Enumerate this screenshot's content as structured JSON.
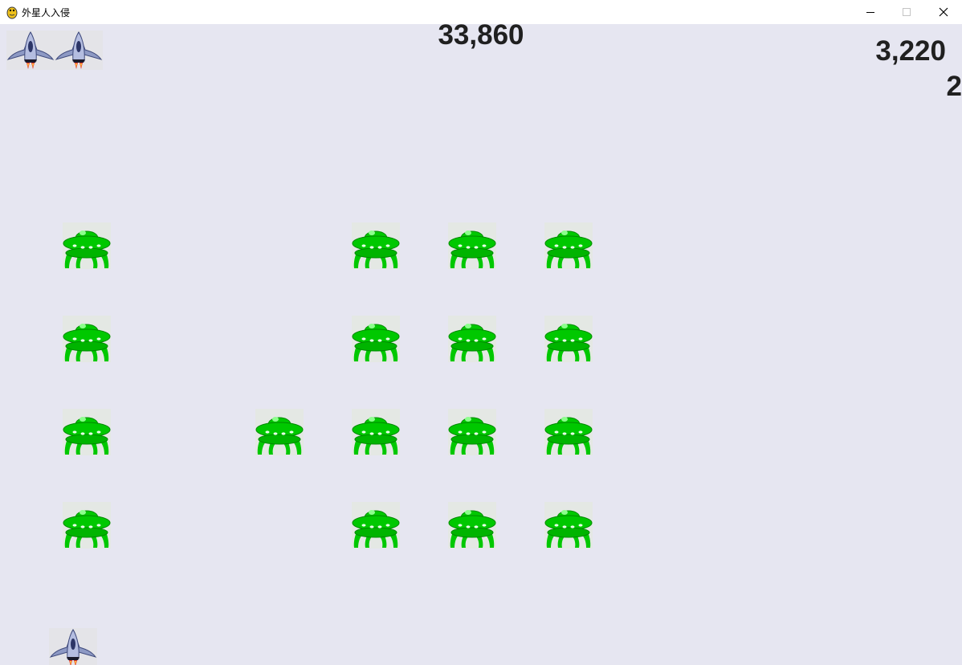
{
  "window": {
    "title": "外星人入侵",
    "icon": "pygame-snake-icon"
  },
  "controls": {
    "minimize": "minimize-icon",
    "maximize": "maximize-icon",
    "close": "close-icon"
  },
  "hud": {
    "high_score": "33,860",
    "score": "3,220",
    "level": "2",
    "lives": 2
  },
  "colors": {
    "background": "#e6e6f1",
    "alien": "#00c800",
    "ship_body": "#7a87b5",
    "text": "#202020"
  },
  "aliens": {
    "rows": 4,
    "cols": 6,
    "present": [
      [
        true,
        false,
        false,
        true,
        true,
        true
      ],
      [
        true,
        false,
        false,
        true,
        true,
        true
      ],
      [
        true,
        false,
        true,
        true,
        true,
        true
      ],
      [
        true,
        false,
        false,
        true,
        true,
        true
      ]
    ]
  },
  "player": {
    "icon": "player-ship-icon"
  }
}
